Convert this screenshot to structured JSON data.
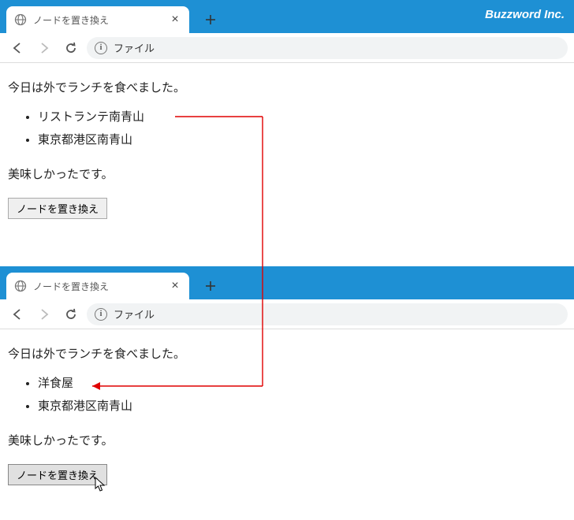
{
  "brand": "Buzzword Inc.",
  "tab_title": "ノードを置き換え",
  "url_label": "ファイル",
  "window_top": {
    "paragraph1": "今日は外でランチを食べました。",
    "list": [
      "リストランテ南青山",
      "東京都港区南青山"
    ],
    "paragraph2": "美味しかったです。",
    "button_label": "ノードを置き換え"
  },
  "window_bottom": {
    "paragraph1": "今日は外でランチを食べました。",
    "list": [
      "洋食屋",
      "東京都港区南青山"
    ],
    "paragraph2": "美味しかったです。",
    "button_label": "ノードを置き換え"
  }
}
